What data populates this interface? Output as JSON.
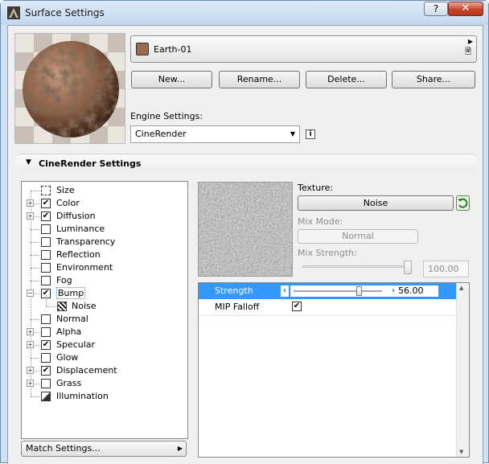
{
  "window": {
    "title": "Surface Settings",
    "help_label": "?",
    "close_label": "✕"
  },
  "material": {
    "name": "Earth-01",
    "color": "#9a6a4e"
  },
  "buttons": {
    "new": "New...",
    "rename": "Rename...",
    "delete": "Delete...",
    "share": "Share..."
  },
  "engine": {
    "label": "Engine Settings:",
    "value": "CineRender"
  },
  "section": {
    "title": "CineRender Settings"
  },
  "tree": [
    {
      "label": "Size",
      "checked": false,
      "expandable": false,
      "icon": "size-icon"
    },
    {
      "label": "Color",
      "checked": true,
      "expandable": true
    },
    {
      "label": "Diffusion",
      "checked": true,
      "expandable": true
    },
    {
      "label": "Luminance",
      "checked": false,
      "expandable": false
    },
    {
      "label": "Transparency",
      "checked": false,
      "expandable": false
    },
    {
      "label": "Reflection",
      "checked": false,
      "expandable": false
    },
    {
      "label": "Environment",
      "checked": false,
      "expandable": false
    },
    {
      "label": "Fog",
      "checked": false,
      "expandable": false
    },
    {
      "label": "Bump",
      "checked": true,
      "expandable": true,
      "expanded": true,
      "selected": true
    },
    {
      "label": "Noise",
      "child": true,
      "icon": "noise-icon"
    },
    {
      "label": "Normal",
      "checked": false,
      "expandable": false
    },
    {
      "label": "Alpha",
      "checked": false,
      "expandable": true
    },
    {
      "label": "Specular",
      "checked": true,
      "expandable": true
    },
    {
      "label": "Glow",
      "checked": false,
      "expandable": false
    },
    {
      "label": "Displacement",
      "checked": true,
      "expandable": true
    },
    {
      "label": "Grass",
      "checked": false,
      "expandable": true
    },
    {
      "label": "Illumination",
      "checked": false,
      "expandable": false,
      "icon": "illumination-icon"
    }
  ],
  "match_settings": "Match Settings...",
  "texture": {
    "label": "Texture:",
    "button": "Noise",
    "mix_mode_label": "Mix Mode:",
    "mix_mode_value": "Normal",
    "mix_strength_label": "Mix Strength:",
    "mix_strength_value": "100.00",
    "mix_strength_fraction": 1.0
  },
  "params": {
    "strength_label": "Strength",
    "strength_value": "56.00",
    "strength_fraction": 0.56,
    "mip_label": "MIP Falloff",
    "mip_checked": true
  }
}
